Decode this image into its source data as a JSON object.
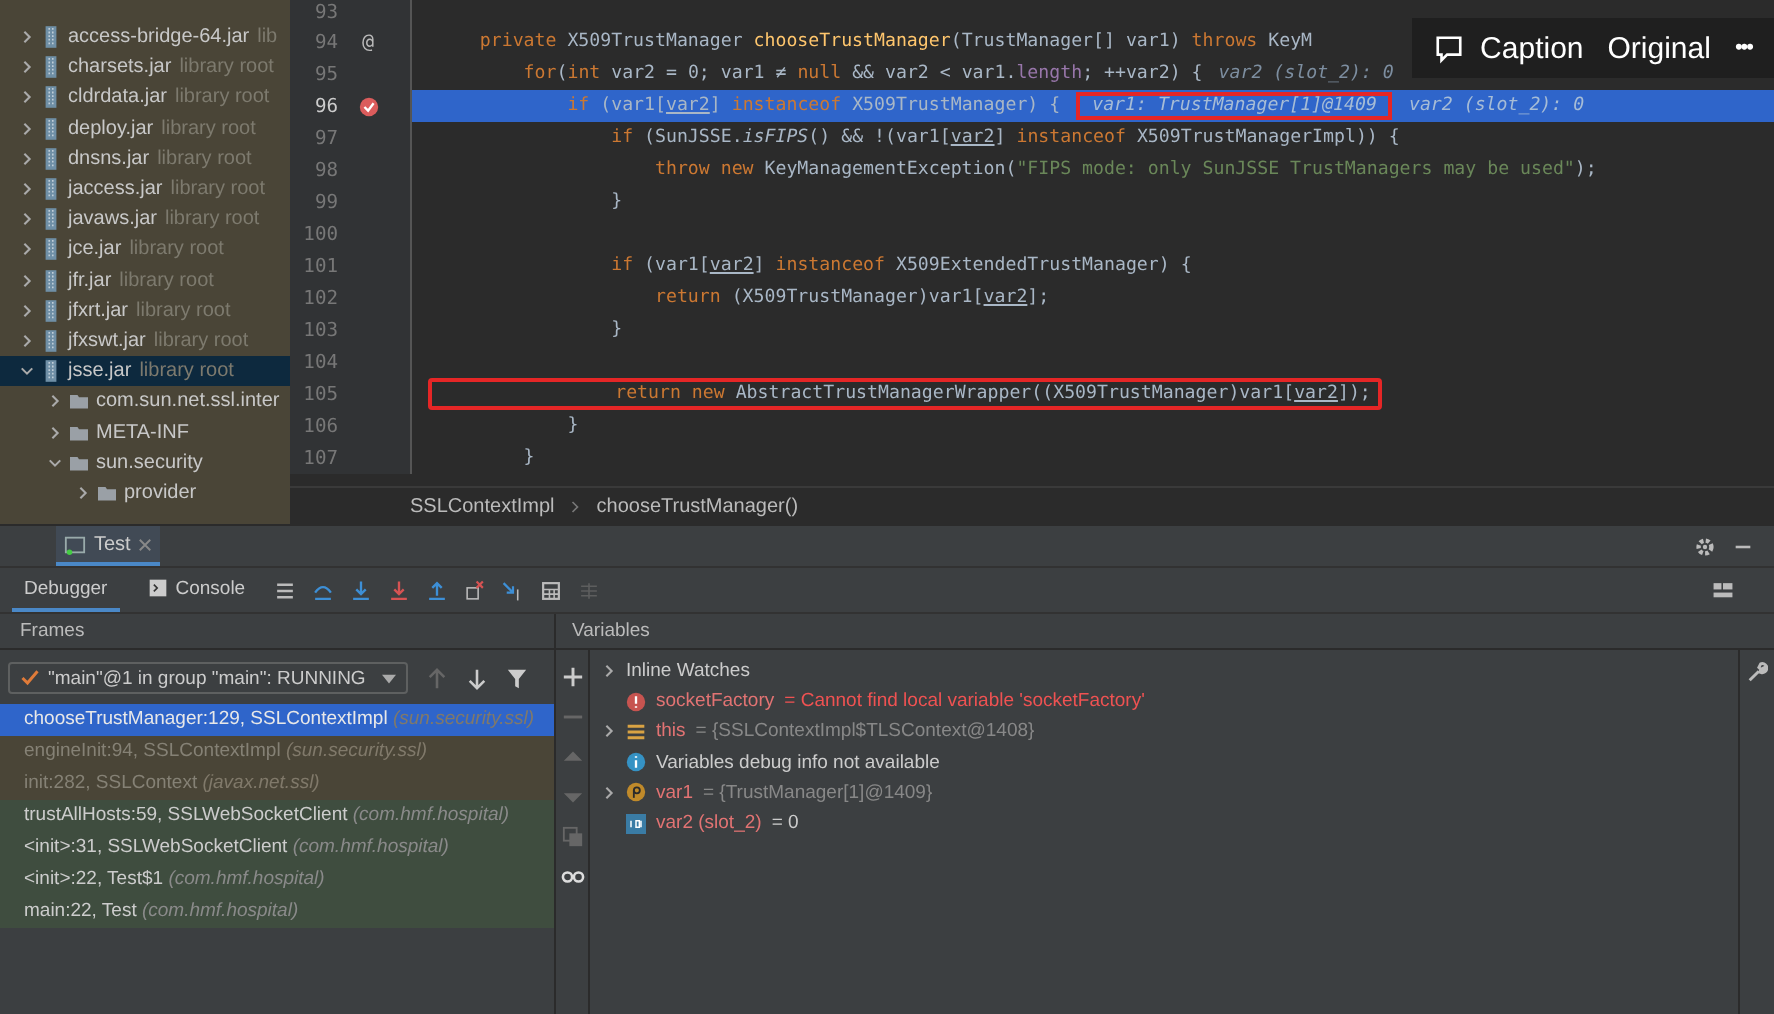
{
  "project_tree": [
    {
      "name": "access-bridge-64.jar",
      "suffix": "lib",
      "kind": "jar",
      "expanded": false,
      "selected": false
    },
    {
      "name": "charsets.jar",
      "suffix": "library root",
      "kind": "jar",
      "expanded": false,
      "selected": false
    },
    {
      "name": "cldrdata.jar",
      "suffix": "library root",
      "kind": "jar",
      "expanded": false,
      "selected": false
    },
    {
      "name": "deploy.jar",
      "suffix": "library root",
      "kind": "jar",
      "expanded": false,
      "selected": false
    },
    {
      "name": "dnsns.jar",
      "suffix": "library root",
      "kind": "jar",
      "expanded": false,
      "selected": false
    },
    {
      "name": "jaccess.jar",
      "suffix": "library root",
      "kind": "jar",
      "expanded": false,
      "selected": false
    },
    {
      "name": "javaws.jar",
      "suffix": "library root",
      "kind": "jar",
      "expanded": false,
      "selected": false
    },
    {
      "name": "jce.jar",
      "suffix": "library root",
      "kind": "jar",
      "expanded": false,
      "selected": false
    },
    {
      "name": "jfr.jar",
      "suffix": "library root",
      "kind": "jar",
      "expanded": false,
      "selected": false
    },
    {
      "name": "jfxrt.jar",
      "suffix": "library root",
      "kind": "jar",
      "expanded": false,
      "selected": false
    },
    {
      "name": "jfxswt.jar",
      "suffix": "library root",
      "kind": "jar",
      "expanded": false,
      "selected": false
    },
    {
      "name": "jsse.jar",
      "suffix": "library root",
      "kind": "jar",
      "expanded": true,
      "selected": true,
      "children": [
        {
          "name": "com.sun.net.ssl.inter",
          "kind": "folder",
          "expanded": false,
          "selected": false
        },
        {
          "name": "META-INF",
          "kind": "folder",
          "expanded": false,
          "selected": false
        },
        {
          "name": "sun.security",
          "kind": "folder",
          "expanded": true,
          "selected": false,
          "children": [
            {
              "name": "provider",
              "kind": "folder",
              "expanded": false,
              "selected": false
            }
          ]
        }
      ]
    }
  ],
  "editor": {
    "lines": [
      {
        "number": "93",
        "breakpoint": false,
        "current": false
      },
      {
        "number": "94",
        "gutter_mark": "@",
        "breakpoint": false,
        "current": false,
        "boxed": false,
        "tokens": [
          {
            "kind": "kw",
            "t": "    private "
          },
          {
            "kind": "plain",
            "t": "X509TrustManager "
          },
          {
            "kind": "fn",
            "t": "chooseTrustManager"
          },
          {
            "kind": "plain",
            "t": "(TrustManager[] var1) "
          },
          {
            "kind": "kw",
            "t": "throws "
          },
          {
            "kind": "plain",
            "t": "KeyM"
          }
        ]
      },
      {
        "number": "95",
        "breakpoint": false,
        "current": false,
        "boxed": false,
        "tokens": [
          {
            "kind": "kw",
            "t": "        for"
          },
          {
            "kind": "plain",
            "t": "("
          },
          {
            "kind": "kw",
            "t": "int "
          },
          {
            "kind": "plain",
            "t": "var2 = 0; var1 ≠ "
          },
          {
            "kind": "kw",
            "t": "null "
          },
          {
            "kind": "plain",
            "t": "&& var2 < var1."
          },
          {
            "kind": "field",
            "t": "length"
          },
          {
            "kind": "plain",
            "t": "; ++var2) {"
          },
          {
            "kind": "hint",
            "t": "var2 (slot_2): 0"
          }
        ]
      },
      {
        "number": "96",
        "breakpoint": true,
        "current": true,
        "boxed": false,
        "tokens": [
          {
            "kind": "kw",
            "t": "            if "
          },
          {
            "kind": "plain",
            "t": "(var1["
          },
          {
            "kind": "ref",
            "t": "var2"
          },
          {
            "kind": "plain",
            "t": "] "
          },
          {
            "kind": "kw",
            "t": "instanceof "
          },
          {
            "kind": "plain",
            "t": "X509TrustManager) {"
          },
          {
            "kind": "boxhint",
            "t": "var1: TrustManager[1]@1409"
          },
          {
            "kind": "hint",
            "t": "var2 (slot_2): 0"
          }
        ]
      },
      {
        "number": "97",
        "breakpoint": false,
        "current": false,
        "boxed": false,
        "tokens": [
          {
            "kind": "kw",
            "t": "                if "
          },
          {
            "kind": "plain",
            "t": "(SunJSSE."
          },
          {
            "kind": "static",
            "t": "isFIPS"
          },
          {
            "kind": "plain",
            "t": "() && !(var1["
          },
          {
            "kind": "ref",
            "t": "var2"
          },
          {
            "kind": "plain",
            "t": "] "
          },
          {
            "kind": "kw",
            "t": "instanceof "
          },
          {
            "kind": "plain",
            "t": "X509TrustManagerImpl)) {"
          }
        ]
      },
      {
        "number": "98",
        "breakpoint": false,
        "current": false,
        "boxed": false,
        "tokens": [
          {
            "kind": "kw",
            "t": "                    throw new "
          },
          {
            "kind": "plain",
            "t": "KeyManagementException("
          },
          {
            "kind": "str",
            "t": "\"FIPS mode: only SunJSSE TrustManagers may be used\""
          },
          {
            "kind": "plain",
            "t": ");"
          }
        ]
      },
      {
        "number": "99",
        "breakpoint": false,
        "current": false,
        "boxed": false,
        "tokens": [
          {
            "kind": "plain",
            "t": "                }"
          }
        ]
      },
      {
        "number": "100",
        "breakpoint": false,
        "current": false
      },
      {
        "number": "101",
        "breakpoint": false,
        "current": false,
        "boxed": false,
        "tokens": [
          {
            "kind": "kw",
            "t": "                if "
          },
          {
            "kind": "plain",
            "t": "(var1["
          },
          {
            "kind": "ref",
            "t": "var2"
          },
          {
            "kind": "plain",
            "t": "] "
          },
          {
            "kind": "kw",
            "t": "instanceof "
          },
          {
            "kind": "plain",
            "t": "X509ExtendedTrustManager) {"
          }
        ]
      },
      {
        "number": "102",
        "breakpoint": false,
        "current": false,
        "boxed": false,
        "tokens": [
          {
            "kind": "kw",
            "t": "                    return "
          },
          {
            "kind": "plain",
            "t": "(X509TrustManager)var1["
          },
          {
            "kind": "ref",
            "t": "var2"
          },
          {
            "kind": "plain",
            "t": "];"
          }
        ]
      },
      {
        "number": "103",
        "breakpoint": false,
        "current": false,
        "boxed": false,
        "tokens": [
          {
            "kind": "plain",
            "t": "                }"
          }
        ]
      },
      {
        "number": "104",
        "breakpoint": false,
        "current": false
      },
      {
        "number": "105",
        "breakpoint": false,
        "current": false,
        "boxed": true,
        "tokens": [
          {
            "kind": "kw",
            "t": "                return new "
          },
          {
            "kind": "plain",
            "t": "AbstractTrustManagerWrapper((X509TrustManager)var1["
          },
          {
            "kind": "ref",
            "t": "var2"
          },
          {
            "kind": "plain",
            "t": "]);"
          }
        ]
      },
      {
        "number": "106",
        "breakpoint": false,
        "current": false,
        "boxed": false,
        "tokens": [
          {
            "kind": "plain",
            "t": "            }"
          }
        ]
      },
      {
        "number": "107",
        "breakpoint": false,
        "current": false,
        "boxed": false,
        "tokens": [
          {
            "kind": "plain",
            "t": "        }"
          }
        ]
      }
    ],
    "breadcrumbs": [
      "SSLContextImpl",
      "chooseTrustManager()"
    ]
  },
  "viewer_toolbar": {
    "buttons": [
      {
        "kind": "comment",
        "label": "Caption"
      },
      {
        "kind": "plain",
        "label": "Original"
      },
      {
        "kind": "more",
        "label": "•••"
      }
    ]
  },
  "run_tabs": [
    {
      "label": "Test",
      "selected": true
    }
  ],
  "debugger_tabs": [
    {
      "label": "Debugger",
      "kind": "debugger",
      "selected": true
    },
    {
      "label": "Console",
      "kind": "console",
      "selected": false
    }
  ],
  "frames": {
    "title": "Frames",
    "thread": "\"main\"@1 in group \"main\": RUNNING",
    "items": [
      {
        "method": "chooseTrustManager:129, SSLContextImpl",
        "package": "(sun.security.ssl)",
        "kind": "library",
        "selected": true
      },
      {
        "method": "engineInit:94, SSLContextImpl",
        "package": "(sun.security.ssl)",
        "kind": "library",
        "selected": false
      },
      {
        "method": "init:282, SSLContext",
        "package": "(javax.net.ssl)",
        "kind": "library",
        "selected": false
      },
      {
        "method": "trustAllHosts:59, SSLWebSocketClient",
        "package": "(com.hmf.hospital)",
        "kind": "user",
        "selected": false
      },
      {
        "method": "<init>:31, SSLWebSocketClient",
        "package": "(com.hmf.hospital)",
        "kind": "user",
        "selected": false
      },
      {
        "method": "<init>:22, Test$1",
        "package": "(com.hmf.hospital)",
        "kind": "user",
        "selected": false
      },
      {
        "method": "main:22, Test",
        "package": "(com.hmf.hospital)",
        "kind": "user",
        "selected": false
      }
    ]
  },
  "variables": {
    "title": "Variables",
    "items": [
      {
        "kind": "group",
        "name": "Inline Watches",
        "expandable": true
      },
      {
        "kind": "error",
        "name": "socketFactory",
        "value": "= Cannot find local variable 'socketFactory'",
        "expandable": false
      },
      {
        "kind": "object",
        "name": "this",
        "value": "= {SSLContextImpl$TLSContext@1408}",
        "expandable": true
      },
      {
        "kind": "info",
        "name": "Variables debug info not available",
        "expandable": false
      },
      {
        "kind": "param",
        "name": "var1",
        "value": "= {TrustManager[1]@1409}",
        "expandable": true
      },
      {
        "kind": "primitive",
        "name": "var2 (slot_2)",
        "value": "= 0",
        "expandable": false
      }
    ]
  }
}
